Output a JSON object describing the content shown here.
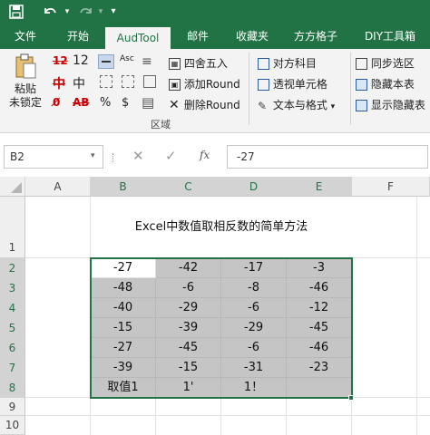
{
  "quick_access": {
    "save_icon": "save-icon",
    "undo_icon": "undo-icon",
    "redo_icon": "redo-icon",
    "customize_icon": "customize-qat-icon"
  },
  "tabs": [
    "文件",
    "开始",
    "AudTool",
    "邮件",
    "收藏夹",
    "方方格子",
    "DIY工具箱"
  ],
  "active_tab": "AudTool",
  "ribbon": {
    "paste_label_1": "粘贴",
    "paste_label_2": "未锁定",
    "font_size_value": "12",
    "chinese_label": "中",
    "abc_label": "Asc",
    "round_label": "四舍五入",
    "add_round_label": "添加Round",
    "delete_round_label": "删除Round",
    "group_label": "区域",
    "compare_label": "对方科目",
    "pivot_label": "透视单元格",
    "text_format_label": "文本与格式",
    "sync_label": "同步选区",
    "hide_book_label": "隐藏本表",
    "show_table_label": "显示隐藏表",
    "percent_symbol": "%",
    "dollar_symbol": "$"
  },
  "formula_bar": {
    "name_box": "B2",
    "cancel_icon": "cancel-icon",
    "confirm_icon": "confirm-icon",
    "fx_label": "fx",
    "formula_value": "-27"
  },
  "sheet": {
    "columns": [
      "A",
      "B",
      "C",
      "D",
      "E",
      "F"
    ],
    "rows": [
      "1",
      "2",
      "3",
      "4",
      "5",
      "6",
      "7",
      "8",
      "9",
      "10"
    ],
    "title": "Excel中数值取相反数的简单方法",
    "table": [
      [
        "-27",
        "-42",
        "-17",
        "-3"
      ],
      [
        "-48",
        "-6",
        "-8",
        "-46"
      ],
      [
        "-40",
        "-29",
        "-6",
        "-12"
      ],
      [
        "-15",
        "-39",
        "-29",
        "-45"
      ],
      [
        "-27",
        "-45",
        "-6",
        "-46"
      ],
      [
        "-39",
        "-15",
        "-31",
        "-23"
      ],
      [
        "取值1",
        "1'",
        "1！",
        ""
      ]
    ]
  },
  "colors": {
    "excel_green": "#217346",
    "selection_gray": "#c5c5c5"
  }
}
